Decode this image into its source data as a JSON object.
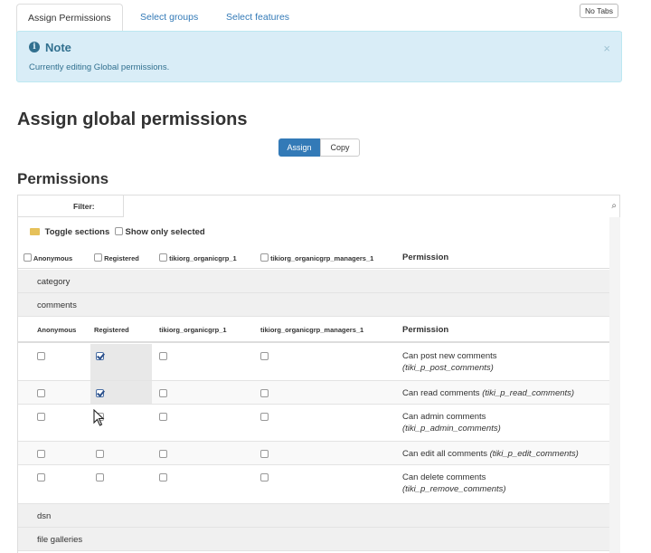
{
  "tabs": [
    {
      "label": "Assign Permissions"
    },
    {
      "label": "Select groups"
    },
    {
      "label": "Select features"
    }
  ],
  "notabs_label": "No Tabs",
  "note": {
    "title": "Note",
    "text": "Currently editing Global permissions.",
    "close": "×"
  },
  "page_title": "Assign global permissions",
  "buttons": {
    "assign": "Assign",
    "copy": "Copy"
  },
  "section_title": "Permissions",
  "filter": {
    "label": "Filter:",
    "value": ""
  },
  "toggle_sections": "Toggle sections",
  "show_only_selected": "Show only selected",
  "top_header": {
    "groups": [
      "Anonymous",
      "Registered",
      "tikiorg_organicgrp_1",
      "tikiorg_organicgrp_managers_1"
    ],
    "permission": "Permission"
  },
  "sections": [
    "category",
    "comments",
    "dsn",
    "file galleries"
  ],
  "sub_header": {
    "groups": [
      "Anonymous",
      "Registered",
      "tikiorg_organicgrp_1",
      "tikiorg_organicgrp_managers_1"
    ],
    "permission": "Permission"
  },
  "permissions": [
    {
      "label": "Can post new comments",
      "code": "(tiki_p_post_comments)",
      "inline": false,
      "checked": [
        false,
        true,
        false,
        false
      ]
    },
    {
      "label": "Can read comments",
      "code": "(tiki_p_read_comments)",
      "inline": true,
      "checked": [
        false,
        true,
        false,
        false
      ]
    },
    {
      "label": "Can admin comments",
      "code": "(tiki_p_admin_comments)",
      "inline": false,
      "checked": [
        false,
        false,
        false,
        false
      ]
    },
    {
      "label": "Can edit all comments",
      "code": "(tiki_p_edit_comments)",
      "inline": true,
      "checked": [
        false,
        false,
        false,
        false
      ]
    },
    {
      "label": "Can delete comments",
      "code": "(tiki_p_remove_comments)",
      "inline": false,
      "checked": [
        false,
        false,
        false,
        false
      ]
    }
  ],
  "colors": {
    "primary": "#337ab7",
    "note_bg": "#d9edf7",
    "note_text": "#31708f"
  }
}
